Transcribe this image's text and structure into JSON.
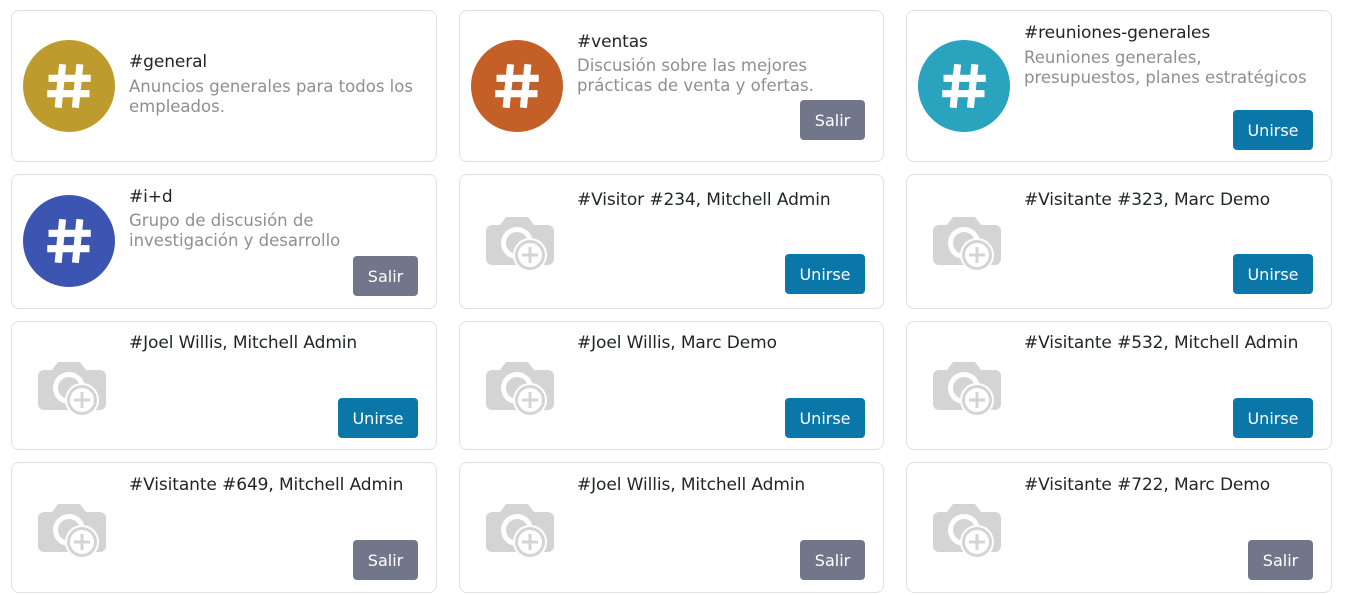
{
  "colors": {
    "general": "#bd9c2d",
    "ventas": "#c46027",
    "reuniones": "#2aa3bf",
    "id": "#3b55b0",
    "join": "#0b77a8",
    "leave": "#71768a"
  },
  "channels": [
    {
      "title": "#general",
      "desc": "Anuncios generales para todos los empleados.",
      "button": ""
    },
    {
      "title": "#ventas",
      "desc": "Discusión sobre las mejores prácticas de venta y ofertas.",
      "button": "Salir"
    },
    {
      "title": "#reuniones-generales",
      "desc": "Reuniones generales, presupuestos, planes estratégicos",
      "button": "Unirse"
    },
    {
      "title": "#i+d",
      "desc": "Grupo de discusión de investigación y desarrollo",
      "button": "Salir"
    },
    {
      "title": "#Visitor #234, Mitchell Admin",
      "desc": "",
      "button": "Unirse"
    },
    {
      "title": "#Visitante #323, Marc Demo",
      "desc": "",
      "button": "Unirse"
    },
    {
      "title": "#Joel Willis, Mitchell Admin",
      "desc": "",
      "button": "Unirse"
    },
    {
      "title": "#Joel Willis, Marc Demo",
      "desc": "",
      "button": "Unirse"
    },
    {
      "title": "#Visitante #532, Mitchell Admin",
      "desc": "",
      "button": "Unirse"
    },
    {
      "title": "#Visitante #649, Mitchell Admin",
      "desc": "",
      "button": "Salir"
    },
    {
      "title": "#Joel Willis, Mitchell Admin",
      "desc": "",
      "button": "Salir"
    },
    {
      "title": "#Visitante #722, Marc Demo",
      "desc": "",
      "button": "Salir"
    }
  ],
  "icons": {
    "channel": "hashtag-icon",
    "chat": "camera-add-icon"
  }
}
